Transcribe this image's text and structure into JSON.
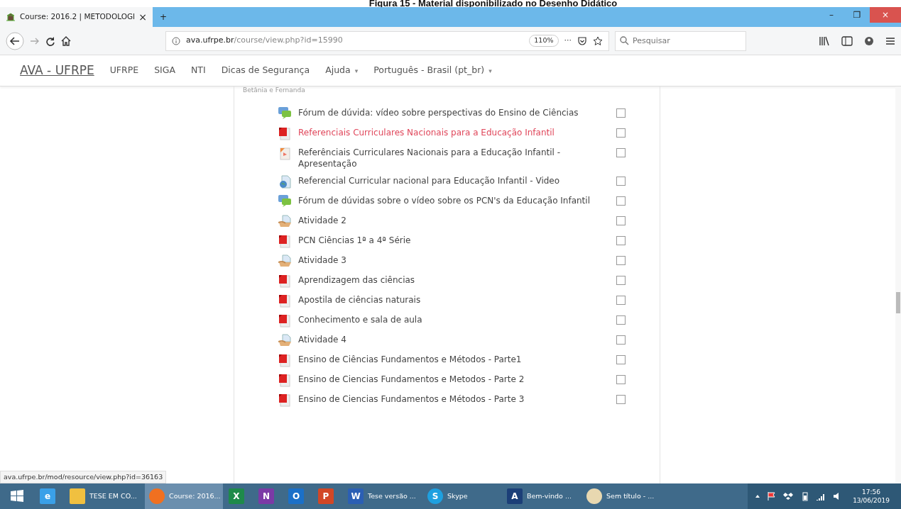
{
  "caption": "Figura 15 - Material disponibilizado no Desenho Didático",
  "browser": {
    "tab": {
      "title": "Course: 2016.2 | METODOLOGI",
      "close": "×",
      "selected": true
    },
    "new_tab": "+",
    "window_controls": [
      "–",
      "❐",
      "×"
    ],
    "url": {
      "host": "ava.ufrpe.br",
      "path": "/course/view.php?id=15990"
    },
    "zoom": "110%",
    "more": "···",
    "search": {
      "placeholder": "Pesquisar"
    }
  },
  "navbar": {
    "brand": "AVA - UFRPE",
    "items": [
      {
        "label": "UFRPE"
      },
      {
        "label": "SIGA"
      },
      {
        "label": "NTI"
      },
      {
        "label": "Dicas de Segurança"
      },
      {
        "label": "Ajuda",
        "caret": "▾"
      },
      {
        "label": "Português - Brasil (pt_br)",
        "caret": "▾"
      }
    ]
  },
  "section_note": "Betânia e Fernanda",
  "activities": [
    {
      "kind": "forum",
      "title": "Fórum de dúvida: vídeo sobre perspectivas do Ensino de Ciências",
      "highlighted": false,
      "checked": false
    },
    {
      "kind": "pdf",
      "title": "Referenciais Curriculares Nacionais para a Educação Infantil",
      "highlighted": true,
      "checked": false
    },
    {
      "kind": "slides",
      "title": "Referênciais Curriculares Nacionais para a Educação Infantil - Apresentação",
      "highlighted": false,
      "checked": false
    },
    {
      "kind": "url",
      "title": "Referencial Curricular nacional para Educação Infantil - Video",
      "highlighted": false,
      "checked": false
    },
    {
      "kind": "forum",
      "title": "Fórum de dúvidas sobre o vídeo sobre os PCN's da Educação Infantil",
      "highlighted": false,
      "checked": false
    },
    {
      "kind": "assign",
      "title": "Atividade 2",
      "highlighted": false,
      "checked": false
    },
    {
      "kind": "pdf",
      "title": "PCN Ciências 1ª a 4ª Série",
      "highlighted": false,
      "checked": false
    },
    {
      "kind": "assign",
      "title": "Atividade 3",
      "highlighted": false,
      "checked": false
    },
    {
      "kind": "pdf",
      "title": "Aprendizagem das ciências",
      "highlighted": false,
      "checked": false
    },
    {
      "kind": "pdf",
      "title": "Apostila de ciências naturais",
      "highlighted": false,
      "checked": false
    },
    {
      "kind": "pdf",
      "title": "Conhecimento e sala de aula",
      "highlighted": false,
      "checked": false
    },
    {
      "kind": "assign",
      "title": "Atividade 4",
      "highlighted": false,
      "checked": false
    },
    {
      "kind": "pdf",
      "title": "Ensino de Ciências Fundamentos e Métodos - Parte1",
      "highlighted": false,
      "checked": false
    },
    {
      "kind": "pdf",
      "title": "Ensino de Ciencias Fundamentos e Metodos - Parte 2",
      "highlighted": false,
      "checked": false
    },
    {
      "kind": "pdf",
      "title": "Ensino de Ciencias Fundamentos e Métodos - Parte 3",
      "highlighted": false,
      "checked": false
    }
  ],
  "status_url": "ava.ufrpe.br/mod/resource/view.php?id=36163",
  "taskbar": {
    "items": [
      {
        "kind": "ie",
        "glyph": "e",
        "selected": false
      },
      {
        "kind": "folder",
        "label": "TESE EM CO...",
        "selected": false
      },
      {
        "kind": "firefox",
        "label": "Course: 2016...",
        "selected": true
      },
      {
        "kind": "excel",
        "glyph": "X",
        "selected": false
      },
      {
        "kind": "onenote",
        "glyph": "N",
        "selected": false
      },
      {
        "kind": "outlook",
        "glyph": "O",
        "selected": false
      },
      {
        "kind": "powerpoint",
        "glyph": "P",
        "selected": false
      },
      {
        "kind": "word",
        "glyph": "W",
        "label": "Tese versão ...",
        "selected": false
      },
      {
        "kind": "skype",
        "glyph": "S",
        "label": "Skype",
        "selected": false
      },
      {
        "kind": "app",
        "glyph": "A",
        "label": "Bem-vindo ...",
        "selected": false
      },
      {
        "kind": "paint",
        "label": "Sem título - ...",
        "selected": false
      }
    ],
    "time": "17:56",
    "date": "13/06/2019"
  }
}
